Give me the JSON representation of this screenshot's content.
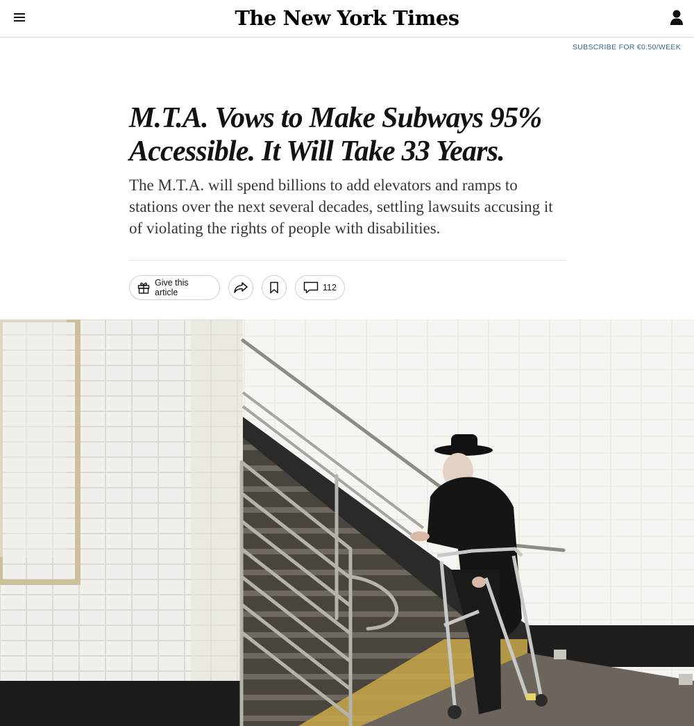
{
  "header": {
    "logo_text": "The New York Times",
    "menu_icon": "hamburger-menu-icon",
    "account_icon": "user-account-icon"
  },
  "subscribe": {
    "label": "SUBSCRIBE FOR €0.50/WEEK"
  },
  "article": {
    "headline": "M.T.A. Vows to Make Subways 95% Accessible. It Will Take 33 Years.",
    "summary": "The M.T.A. will spend billions to add elevators and ramps to stations over the next several decades, settling lawsuits accusing it of violating the rights of people with disabilities."
  },
  "toolbar": {
    "gift_label": "Give this article",
    "gift_icon": "gift-icon",
    "share_icon": "share-icon",
    "save_icon": "bookmark-icon",
    "comments_icon": "comment-icon",
    "comments_count": "112"
  },
  "colors": {
    "subscribe_link": "#326891",
    "text": "#121212",
    "divider": "#e2e2e2"
  }
}
